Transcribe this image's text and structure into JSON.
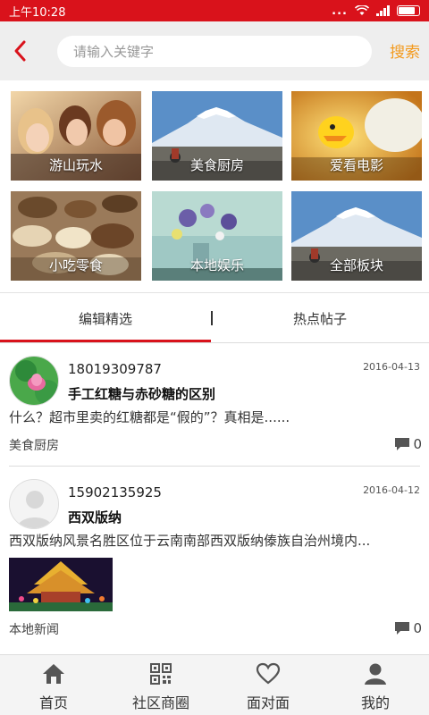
{
  "status_bar": {
    "time": "上午10:28",
    "dots": "..."
  },
  "header": {
    "search_placeholder": "请输入关键字",
    "search_button": "搜索"
  },
  "categories": [
    {
      "label": "游山玩水",
      "icon": "friends-photo"
    },
    {
      "label": "美食厨房",
      "icon": "mountain-photo"
    },
    {
      "label": "爱看电影",
      "icon": "cartoon-photo"
    },
    {
      "label": "小吃零食",
      "icon": "nuts-photo"
    },
    {
      "label": "本地娱乐",
      "icon": "flowers-photo"
    },
    {
      "label": "全部板块",
      "icon": "mountain-photo"
    }
  ],
  "tabs": [
    {
      "label": "编辑精选",
      "active": true
    },
    {
      "label": "热点帖子",
      "active": false
    }
  ],
  "tab_divider": "|",
  "posts": [
    {
      "username": "18019309787",
      "date": "2016-04-13",
      "title": "手工红糖与赤砂糖的区别",
      "excerpt": "什么？超市里卖的红糖都是“假的”？真相是......",
      "category": "美食厨房",
      "comments": "0",
      "avatar": "lotus-avatar"
    },
    {
      "username": "15902135925",
      "date": "2016-04-12",
      "title": "西双版纳",
      "excerpt": "西双版纳风景名胜区位于云南南部西双版纳傣族自治州境内...",
      "category": "本地新闻",
      "comments": "0",
      "avatar": "default-avatar",
      "has_image": true
    }
  ],
  "bottom_nav": [
    {
      "label": "首页",
      "icon": "home-icon"
    },
    {
      "label": "社区商圈",
      "icon": "qr-code-icon"
    },
    {
      "label": "面对面",
      "icon": "heart-icon"
    },
    {
      "label": "我的",
      "icon": "user-icon"
    }
  ],
  "colors": {
    "brand_red": "#d9121b",
    "search_orange": "#f39a1e",
    "header_gray": "#eeeeee"
  }
}
